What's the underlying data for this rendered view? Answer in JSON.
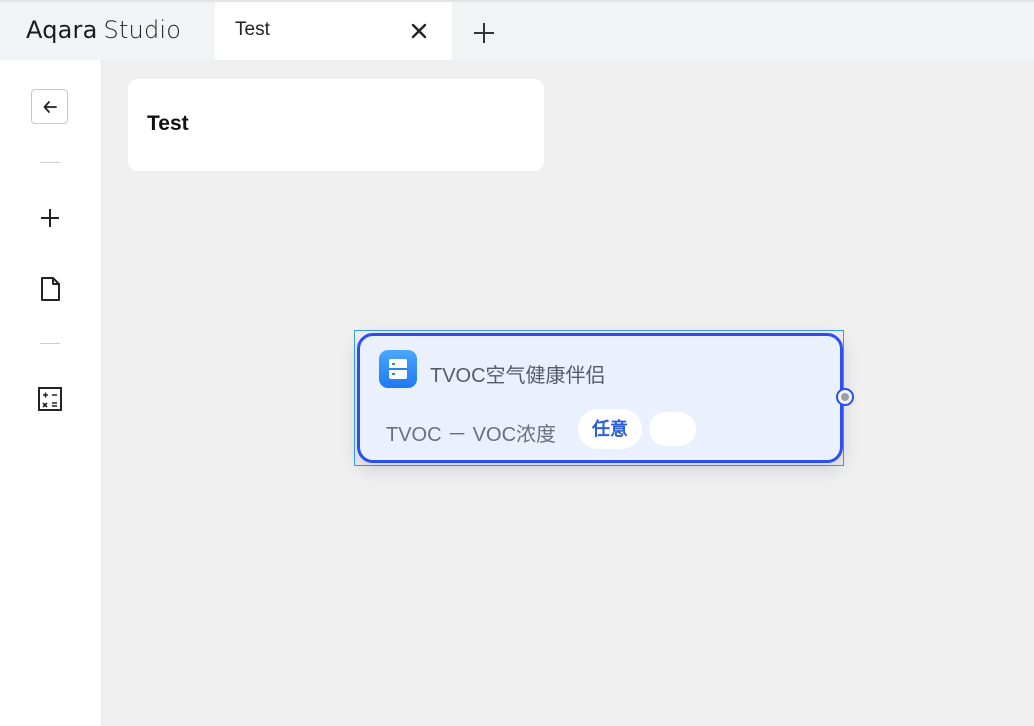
{
  "app": {
    "brand": "Aqara",
    "product": "Studio"
  },
  "tabs": [
    {
      "label": "Test",
      "active": true
    }
  ],
  "icons": {
    "tab_close": "close-icon",
    "tab_add": "plus-icon",
    "back": "arrow-left-icon",
    "add": "plus-icon",
    "document": "document-icon",
    "calculator": "calculator-icon",
    "node_device": "device-icon"
  },
  "canvas": {
    "title": "Test"
  },
  "node": {
    "title": "TVOC空气健康伴侣",
    "condition": "TVOC － VOC浓度",
    "value": "任意",
    "value2": ""
  },
  "colors": {
    "accent": "#2b4ff0",
    "node_bg": "#eaf1fd",
    "pill_text": "#2b5ed8",
    "icon_gradient_top": "#4aa8ff",
    "icon_gradient_bottom": "#1f78f0"
  }
}
